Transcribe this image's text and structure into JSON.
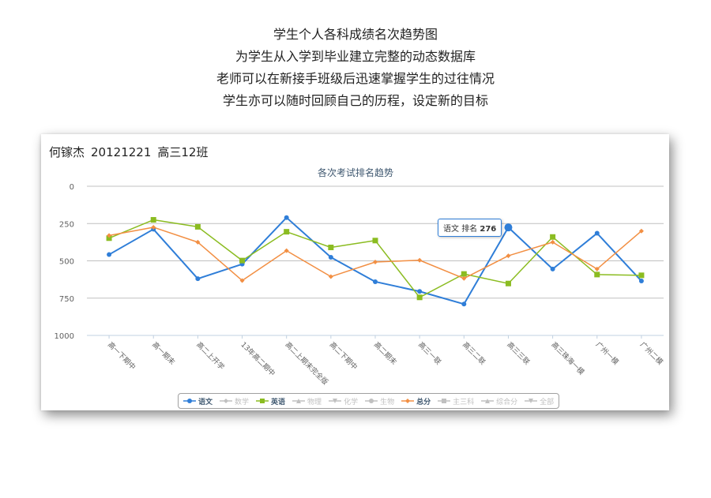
{
  "intro": {
    "lines": [
      "学生个人各科成绩名次趋势图",
      "为学生从入学到毕业建立完整的动态数据库",
      "老师可以在新接手班级后迅速掌握学生的过往情况",
      "学生亦可以随时回顾自己的历程，设定新的目标"
    ]
  },
  "student": {
    "name": "何镓杰",
    "id": "20121221",
    "class": "高三12班"
  },
  "tooltip": {
    "series": "语文",
    "label": "排名",
    "value": "276"
  },
  "chart_data": {
    "type": "line",
    "title": "各次考试排名趋势",
    "xlabel": "",
    "ylabel": "",
    "y_reversed": true,
    "ylim": [
      0,
      1000
    ],
    "yticks": [
      "0",
      "250",
      "500",
      "750",
      "1000"
    ],
    "grid": true,
    "legend_position": "bottom",
    "categories": [
      "高一下期中",
      "高一期末",
      "高二上开学",
      "13年高二期中",
      "高二上期末完全版",
      "高二下期中",
      "高二期末",
      "高三一联",
      "高三二联",
      "高三三联",
      "高三珠海一模",
      "广州一模",
      "广州二模"
    ],
    "series": [
      {
        "name": "语文",
        "color": "#2f7ed8",
        "marker": "circle",
        "visible": true,
        "values": [
          458,
          288,
          620,
          522,
          210,
          476,
          640,
          705,
          790,
          276,
          555,
          315,
          635
        ]
      },
      {
        "name": "数学",
        "visible": false,
        "marker": "diamond",
        "values": []
      },
      {
        "name": "英语",
        "color": "#8bbc21",
        "marker": "square",
        "visible": true,
        "values": [
          348,
          225,
          272,
          498,
          305,
          410,
          364,
          745,
          588,
          652,
          340,
          592,
          597
        ]
      },
      {
        "name": "物理",
        "visible": false,
        "marker": "triangle",
        "values": []
      },
      {
        "name": "化学",
        "visible": false,
        "marker": "triangle-down",
        "values": []
      },
      {
        "name": "生物",
        "visible": false,
        "marker": "circle",
        "values": []
      },
      {
        "name": "总分",
        "color": "#f28f43",
        "marker": "diamond",
        "visible": true,
        "values": [
          330,
          275,
          375,
          632,
          432,
          606,
          508,
          496,
          618,
          466,
          375,
          555,
          300
        ]
      },
      {
        "name": "主三科",
        "visible": false,
        "marker": "square",
        "values": []
      },
      {
        "name": "综合分",
        "visible": false,
        "marker": "triangle",
        "values": []
      },
      {
        "name": "全部",
        "visible": false,
        "marker": "triangle-down",
        "values": []
      }
    ]
  },
  "colors": {
    "grid": "#c0c0c0",
    "axis": "#c0d0e0",
    "title": "#3e576f",
    "tick_label": "#606060",
    "legend_active": "#3e576f",
    "legend_inactive": "#c0c0c0"
  }
}
